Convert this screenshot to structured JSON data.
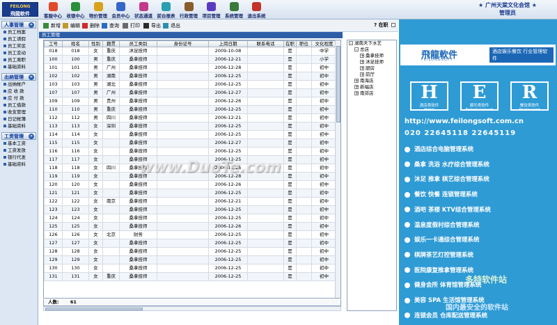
{
  "topbar": {
    "logo_top": "FEILONG",
    "logo": "飛龍軟件",
    "buttons": [
      "客服中心",
      "收银中心",
      "物价管理",
      "会员中心",
      "状态通道",
      "前台报表",
      "行政管理",
      "项目管理",
      "系统管理",
      "退出系统"
    ],
    "company": "★ 广州天棠文化会馆 ★",
    "user": "管理员"
  },
  "sidebar": {
    "groups": [
      {
        "title": "人事管理",
        "items": [
          "员工档案",
          "员工请假",
          "员工奖惩",
          "员工变动",
          "员工离职",
          "基础资料"
        ]
      },
      {
        "title": "出纳管理",
        "items": [
          "出纳帐户",
          "应 收 款",
          "应 付 款",
          "员工借款",
          "收支管理",
          "日记帐簿",
          "基础资料"
        ]
      },
      {
        "title": "工资管理",
        "items": [
          "基本工资",
          "工资发放",
          "银行代发",
          "基础资料"
        ]
      }
    ]
  },
  "toolbar": {
    "buttons": [
      "新增",
      "编辑",
      "删除",
      "查询",
      "打印",
      "导出",
      "退出"
    ],
    "onjob": "在职"
  },
  "panel_title": "员工管理",
  "table": {
    "headers": [
      "工号",
      "姓名",
      "性别",
      "籍贯",
      "员工类别",
      "身份证号",
      "上岗日期",
      "联系电话",
      "在职",
      "职位",
      "文化程度"
    ],
    "rows": [
      [
        "018",
        "018",
        "女",
        "重庆",
        "沐足技师",
        "",
        "2009-10-08",
        "",
        "是",
        "",
        "中学"
      ],
      [
        "100",
        "100",
        "男",
        "重庆",
        "桑拿技师",
        "",
        "2006-12-21",
        "",
        "是",
        "",
        "小学"
      ],
      [
        "101",
        "101",
        "男",
        "广州",
        "桑拿技师",
        "",
        "2006-12-28",
        "",
        "是",
        "",
        "初中"
      ],
      [
        "102",
        "102",
        "男",
        "湖南",
        "桑拿技师",
        "",
        "2006-12-25",
        "",
        "是",
        "",
        "初中"
      ],
      [
        "103",
        "103",
        "男",
        "湖北",
        "桑拿技师",
        "",
        "2006-12-25",
        "",
        "是",
        "",
        "初中"
      ],
      [
        "107",
        "107",
        "男",
        "广州",
        "桑拿技师",
        "",
        "2006-12-27",
        "",
        "是",
        "",
        "初中"
      ],
      [
        "109",
        "109",
        "男",
        "贵州",
        "桑拿技师",
        "",
        "2006-12-26",
        "",
        "是",
        "",
        "初中"
      ],
      [
        "110",
        "110",
        "男",
        "重庆",
        "桑拿技师",
        "",
        "2006-12-25",
        "",
        "是",
        "",
        "初中"
      ],
      [
        "112",
        "112",
        "男",
        "四川",
        "桑拿技师",
        "",
        "2006-12-21",
        "",
        "是",
        "",
        "初中"
      ],
      [
        "113",
        "113",
        "女",
        "深圳",
        "桑拿技师",
        "",
        "2006-12-25",
        "",
        "是",
        "",
        "初中"
      ],
      [
        "114",
        "114",
        "女",
        "",
        "桑拿技师",
        "",
        "2006-12-25",
        "",
        "是",
        "",
        "初中"
      ],
      [
        "115",
        "115",
        "女",
        "",
        "桑拿技师",
        "",
        "2006-12-27",
        "",
        "是",
        "",
        "初中"
      ],
      [
        "116",
        "116",
        "女",
        "",
        "桑拿技师",
        "",
        "2006-12-25",
        "",
        "是",
        "",
        "初中"
      ],
      [
        "117",
        "117",
        "女",
        "",
        "桑拿技师",
        "",
        "2006-12-25",
        "",
        "是",
        "",
        "初中"
      ],
      [
        "118",
        "118",
        "女",
        "四川",
        "桑拿技师",
        "",
        "2006-12-25",
        "",
        "是",
        "",
        "初中"
      ],
      [
        "119",
        "119",
        "女",
        "",
        "桑拿技师",
        "",
        "2006-12-28",
        "",
        "是",
        "",
        "初中"
      ],
      [
        "120",
        "120",
        "女",
        "",
        "桑拿技师",
        "",
        "2006-12-26",
        "",
        "是",
        "",
        "初中"
      ],
      [
        "121",
        "121",
        "女",
        "",
        "桑拿技师",
        "",
        "2006-12-25",
        "",
        "是",
        "",
        "初中"
      ],
      [
        "122",
        "122",
        "女",
        "南京",
        "桑拿技师",
        "",
        "2006-12-21",
        "",
        "是",
        "",
        "初中"
      ],
      [
        "123",
        "123",
        "女",
        "",
        "桑拿技师",
        "",
        "2006-12-25",
        "",
        "是",
        "",
        "初中"
      ],
      [
        "124",
        "124",
        "女",
        "",
        "桑拿技师",
        "",
        "2006-12-25",
        "",
        "是",
        "",
        "初中"
      ],
      [
        "125",
        "125",
        "女",
        "",
        "桑拿技师",
        "",
        "2006-12-26",
        "",
        "是",
        "",
        "初中"
      ],
      [
        "126",
        "126",
        "女",
        "北京",
        "财务",
        "",
        "2006-12-25",
        "",
        "是",
        "",
        "初中"
      ],
      [
        "127",
        "127",
        "女",
        "",
        "桑拿技师",
        "",
        "2006-12-25",
        "",
        "是",
        "",
        "初中"
      ],
      [
        "128",
        "128",
        "女",
        "",
        "桑拿技师",
        "",
        "2006-12-25",
        "",
        "是",
        "",
        "初中"
      ],
      [
        "129",
        "129",
        "女",
        "",
        "桑拿技师",
        "",
        "2006-12-25",
        "",
        "是",
        "",
        "初中"
      ],
      [
        "130",
        "130",
        "女",
        "",
        "桑拿技师",
        "",
        "2006-12-25",
        "",
        "是",
        "",
        "初中"
      ],
      [
        "131",
        "131",
        "女",
        "重庆",
        "桑拿技师",
        "",
        "2006-12-25",
        "",
        "是",
        "",
        "初中"
      ]
    ]
  },
  "footer": {
    "label": "人数:",
    "count": "61"
  },
  "tree": [
    {
      "text": "湖南天下水艺",
      "pm": "-",
      "indent": 0
    },
    {
      "text": "总店",
      "pm": "-",
      "indent": 1
    },
    {
      "text": "桑拿技师",
      "pm": "+",
      "indent": 2
    },
    {
      "text": "沐足技师",
      "pm": "+",
      "indent": 2
    },
    {
      "text": "厨房",
      "pm": "+",
      "indent": 2
    },
    {
      "text": "前厅",
      "pm": "+",
      "indent": 2
    },
    {
      "text": "南海店",
      "pm": "+",
      "indent": 1
    },
    {
      "text": "新福店",
      "pm": "+",
      "indent": 1
    },
    {
      "text": "南郊店",
      "pm": "+",
      "indent": 1
    }
  ],
  "ad": {
    "logo": "飛龍軟件",
    "logo_sub": "FEILONGSOFT",
    "logo_right": "酒店娱乐餐饮 行业管理软件",
    "her": [
      {
        "letter": "H",
        "cn": "酒店类软件",
        "en": "Hotel"
      },
      {
        "letter": "E",
        "cn": "娱乐类软件",
        "en": "Entertainment"
      },
      {
        "letter": "R",
        "cn": "餐饮类软件",
        "en": "Restaurant"
      }
    ],
    "url": "http://www.feilongsoft.com.cn",
    "phone": "020  22645118  22645119",
    "products": [
      "酒店综合电脑管理系统",
      "桑拿 洗浴 水疗综合管理系统",
      "沐足 推拿 棋艺综合管理系统",
      "餐饮 快餐 连锁管理系统",
      "酒吧 茶楼 KTV综合管理系统",
      "温泉度假村综合管理系统",
      "娱乐一卡通综合管理系统",
      "棋牌茶艺灯控管理系统",
      "医院康复推拿管理系统",
      "健身会所 体育馆管理系统",
      "美容 SPA 生活馆管理系统",
      "连锁会员 仓库配送管理系统"
    ]
  },
  "watermarks": {
    "center": "www.DuoTe.com",
    "corner": "多特软件站",
    "corner2": "国内最安全的软件站"
  },
  "colors": {
    "accent": "#2d5fa8",
    "ad_bg": "#2f9bd5"
  }
}
